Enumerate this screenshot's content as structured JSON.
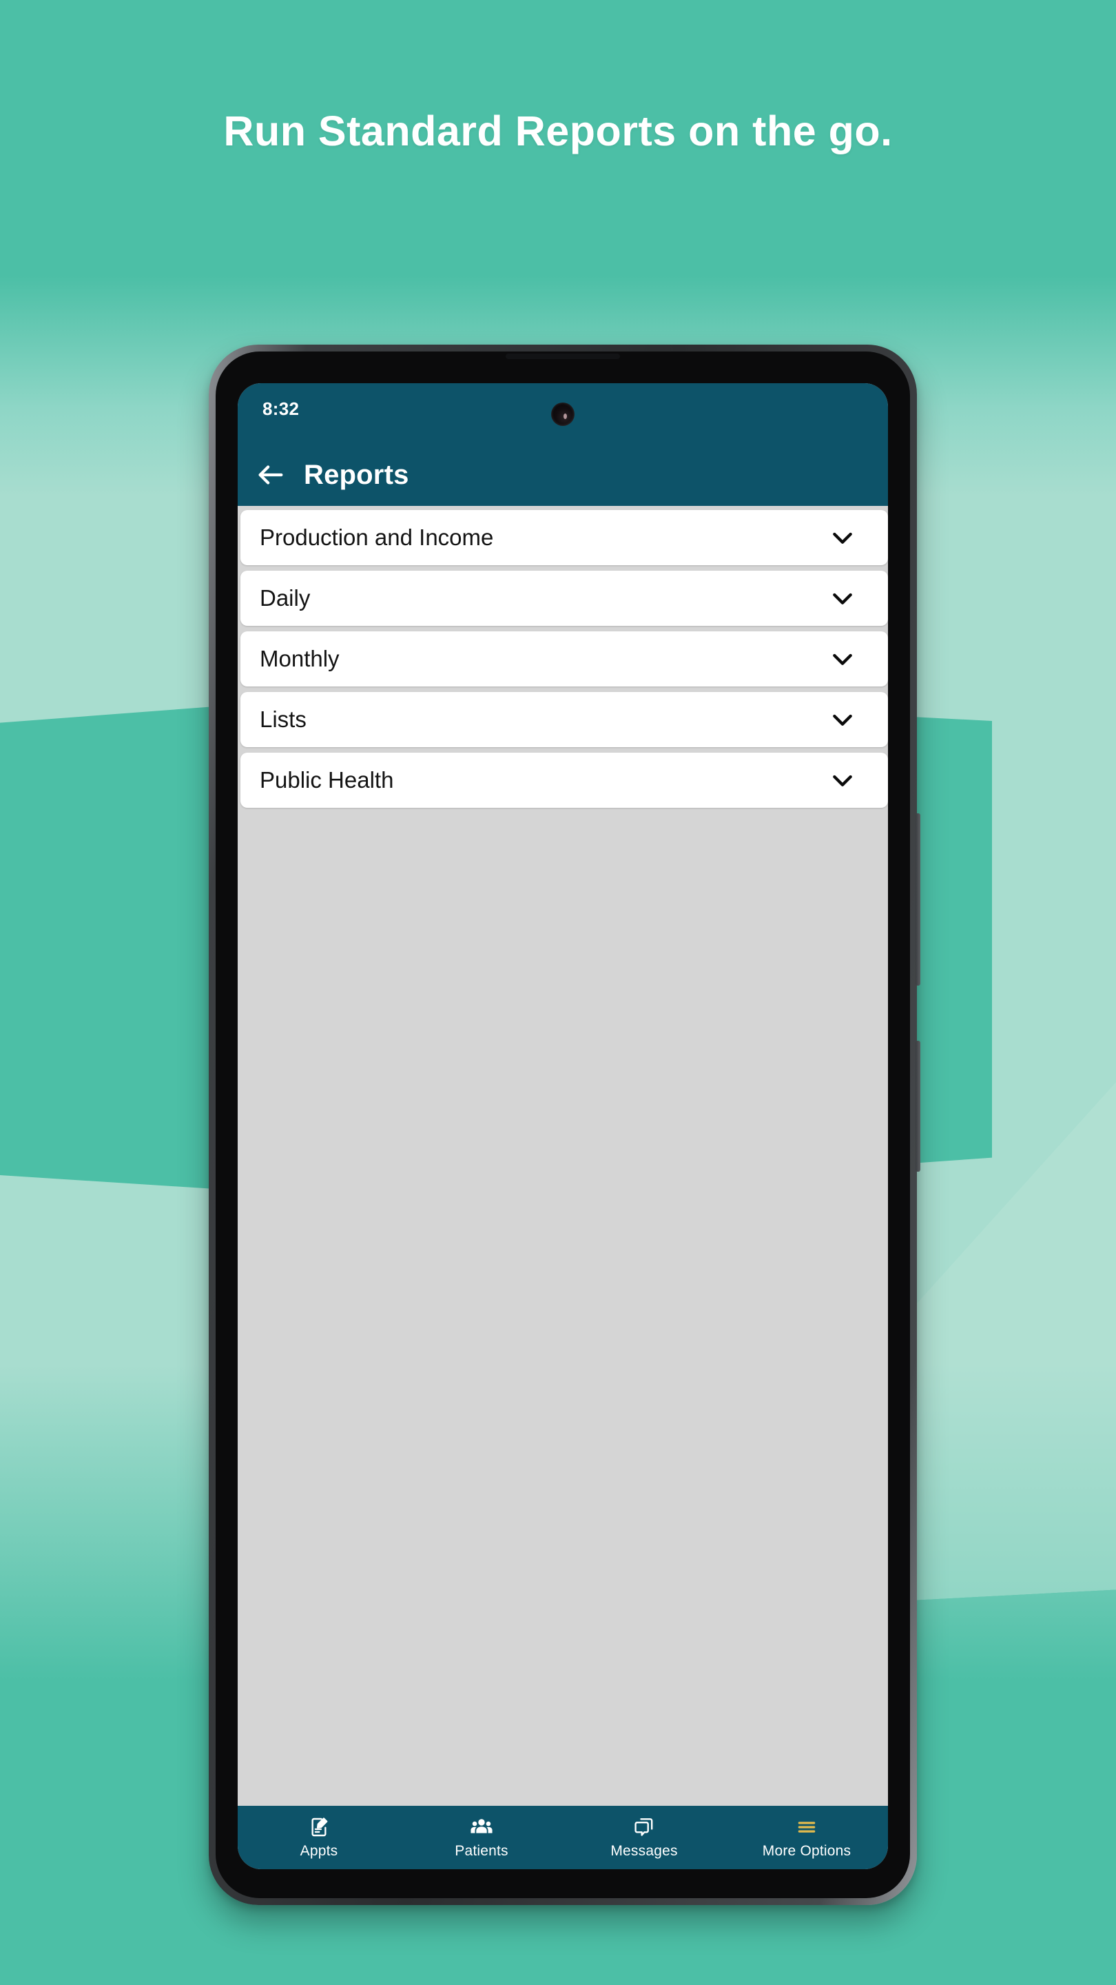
{
  "promo": {
    "headline": "Run Standard Reports on the go.",
    "background_color": "#4cbfa6",
    "background_light_color": "#a8ddcf"
  },
  "phone": {
    "status_bar": {
      "time": "8:32"
    },
    "camera_icon": "camera-punch-hole"
  },
  "app_bar": {
    "back_icon": "arrow-left-icon",
    "title": "Reports",
    "background_color": "#0d5369",
    "text_color": "#ffffff"
  },
  "report_list": {
    "background_color": "#d5d5d5",
    "rows": [
      {
        "label": "Production and Income",
        "chevron_icon": "chevron-down-icon"
      },
      {
        "label": "Daily",
        "chevron_icon": "chevron-down-icon"
      },
      {
        "label": "Monthly",
        "chevron_icon": "chevron-down-icon"
      },
      {
        "label": "Lists",
        "chevron_icon": "chevron-down-icon"
      },
      {
        "label": "Public Health",
        "chevron_icon": "chevron-down-icon"
      }
    ]
  },
  "bottom_nav": {
    "background_color": "#0d5369",
    "active_color": "#e3bb4d",
    "inactive_color": "#ffffff",
    "items": [
      {
        "label": "Appts",
        "icon": "note-pencil-icon",
        "active": false
      },
      {
        "label": "Patients",
        "icon": "people-group-icon",
        "active": false
      },
      {
        "label": "Messages",
        "icon": "chat-bubbles-icon",
        "active": false
      },
      {
        "label": "More Options",
        "icon": "hamburger-menu-icon",
        "active": true
      }
    ]
  }
}
